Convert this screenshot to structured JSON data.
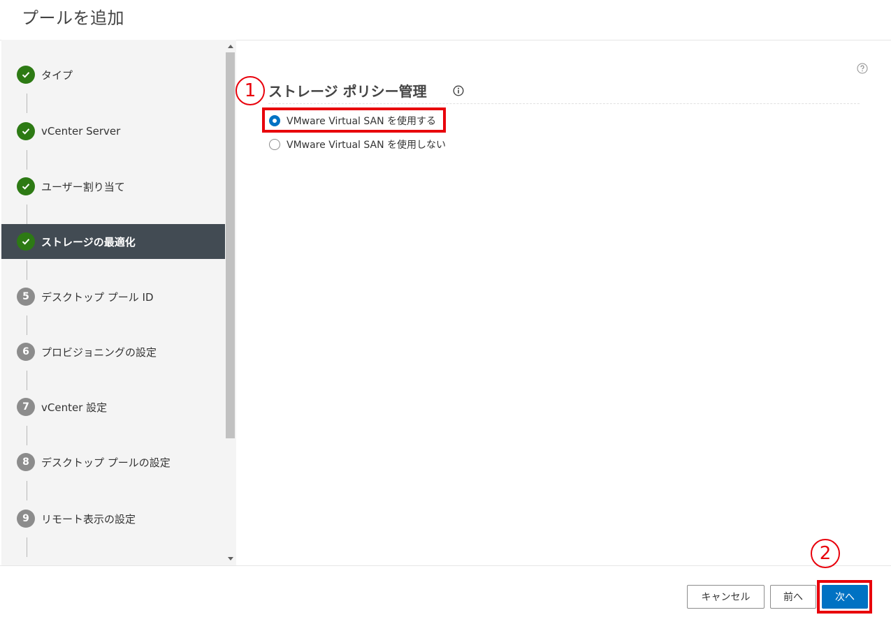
{
  "page": {
    "title": "プールを追加"
  },
  "wizard": {
    "steps": [
      {
        "label": "タイプ",
        "status": "done",
        "icon": "check-icon"
      },
      {
        "label": "vCenter Server",
        "status": "done",
        "icon": "check-icon"
      },
      {
        "label": "ユーザー割り当て",
        "status": "done",
        "icon": "check-icon"
      },
      {
        "label": "ストレージの最適化",
        "status": "done",
        "icon": "check-icon",
        "active": true
      },
      {
        "label": "デスクトップ プール ID",
        "status": "todo",
        "number": "5"
      },
      {
        "label": "プロビジョニングの設定",
        "status": "todo",
        "number": "6"
      },
      {
        "label": "vCenter 設定",
        "status": "todo",
        "number": "7"
      },
      {
        "label": "デスクトップ プールの設定",
        "status": "todo",
        "number": "8"
      },
      {
        "label": "リモート表示の設定",
        "status": "todo",
        "number": "9"
      }
    ]
  },
  "main": {
    "section_title": "ストレージ ポリシー管理",
    "help_icon": "help-circle-icon",
    "info_icon": "info-circle-icon",
    "options": [
      {
        "label": "VMware Virtual SAN を使用する",
        "checked": true
      },
      {
        "label": "VMware Virtual SAN を使用しない",
        "checked": false
      }
    ]
  },
  "footer": {
    "cancel_label": "キャンセル",
    "back_label": "前へ",
    "next_label": "次へ"
  },
  "annotations": {
    "first": "1",
    "second": "2",
    "color": "#e8000b"
  },
  "colors": {
    "accent": "#0072c3",
    "done": "#2d7a14",
    "todo": "#8c8c8c",
    "active_step_bg": "#424b53",
    "sidebar_bg": "#f4f4f4"
  }
}
